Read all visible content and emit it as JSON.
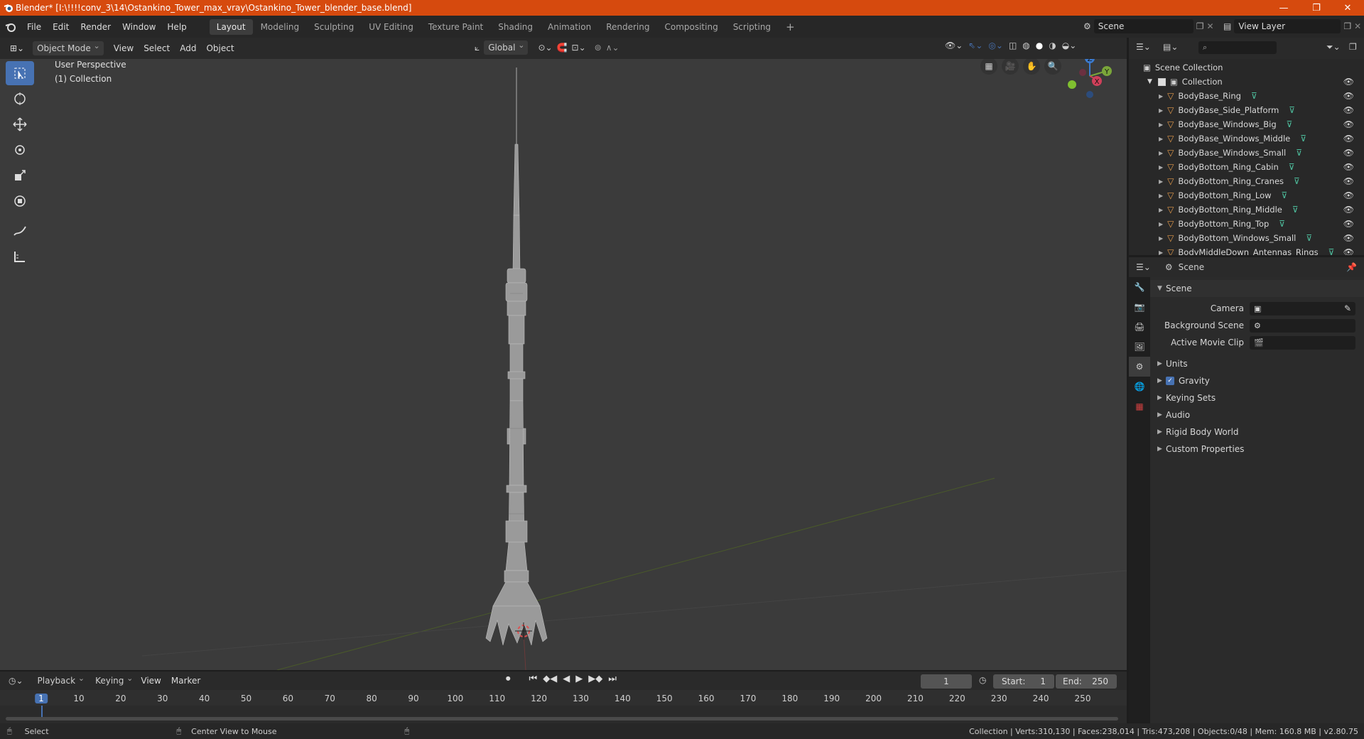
{
  "titlebar": {
    "title": "Blender* [I:\\!!!!conv_3\\14\\Ostankino_Tower_max_vray\\Ostankino_Tower_blender_base.blend]",
    "minimize": "—",
    "restore": "❐",
    "close": "✕"
  },
  "menu": {
    "items": [
      "File",
      "Edit",
      "Render",
      "Window",
      "Help"
    ]
  },
  "workspaces": {
    "tabs": [
      "Layout",
      "Modeling",
      "Sculpting",
      "UV Editing",
      "Texture Paint",
      "Shading",
      "Animation",
      "Rendering",
      "Compositing",
      "Scripting"
    ],
    "add": "+"
  },
  "scene_selector": {
    "value": "Scene"
  },
  "view_layer_selector": {
    "value": "View Layer"
  },
  "viewport_header": {
    "mode": "Object Mode",
    "menus": [
      "View",
      "Select",
      "Add",
      "Object"
    ],
    "orientation": "Global"
  },
  "viewport": {
    "perspective_label": "User Perspective",
    "collection_label": "(1) Collection",
    "gizmo": {
      "z": "Z",
      "y": "Y",
      "x": "X"
    }
  },
  "outliner": {
    "root": "Scene Collection",
    "collection": "Collection",
    "items": [
      "BodyBase_Ring",
      "BodyBase_Side_Platform",
      "BodyBase_Windows_Big",
      "BodyBase_Windows_Middle",
      "BodyBase_Windows_Small",
      "BodyBottom_Ring_Cabin",
      "BodyBottom_Ring_Cranes",
      "BodyBottom_Ring_Low",
      "BodyBottom_Ring_Middle",
      "BodyBottom_Ring_Top",
      "BodyBottom_Windows_Small",
      "BodyMiddleDown_Antennas_Rings"
    ]
  },
  "properties": {
    "header_title": "Scene",
    "panel_title": "Scene",
    "camera_label": "Camera",
    "background_scene_label": "Background Scene",
    "active_clip_label": "Active Movie Clip",
    "subpanels": [
      "Units",
      "Gravity",
      "Keying Sets",
      "Audio",
      "Rigid Body World",
      "Custom Properties"
    ],
    "gravity_checked": true
  },
  "timeline": {
    "menus": [
      "Playback",
      "Keying",
      "View",
      "Marker"
    ],
    "current_frame": "1",
    "start_label": "Start:",
    "start_value": "1",
    "end_label": "End:",
    "end_value": "250",
    "ticks": [
      "1",
      "10",
      "20",
      "30",
      "40",
      "50",
      "60",
      "70",
      "80",
      "90",
      "100",
      "110",
      "120",
      "130",
      "140",
      "150",
      "160",
      "170",
      "180",
      "190",
      "200",
      "210",
      "220",
      "230",
      "240",
      "250"
    ]
  },
  "statusbar": {
    "left_action": "Select",
    "middle_action": "Center View to Mouse",
    "stats": "Collection | Verts:310,130 | Faces:238,014 | Tris:473,208 | Objects:0/48 | Mem: 160.8 MB | v2.80.75"
  },
  "colors": {
    "titlebar": "#d64a0e",
    "accent_blue": "#4772b3",
    "object_orange": "#e49b4b",
    "mesh_green": "#4fc3a1"
  }
}
